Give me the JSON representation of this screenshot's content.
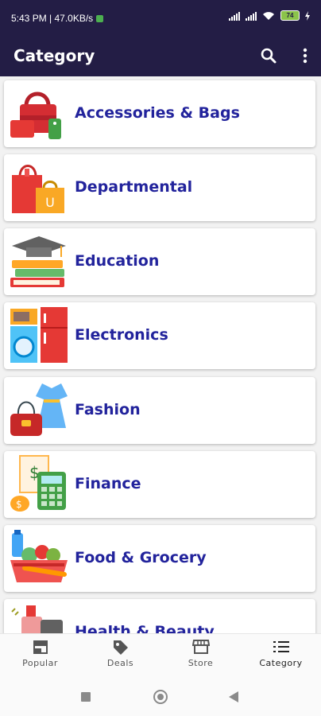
{
  "status_bar": {
    "time_speed": "5:43 PM | 47.0KB/s",
    "battery": "74"
  },
  "app_bar": {
    "title": "Category"
  },
  "categories": [
    {
      "label": "Accessories & Bags",
      "icon": "handbag-icon"
    },
    {
      "label": "Departmental",
      "icon": "shopping-bags-icon"
    },
    {
      "label": "Education",
      "icon": "graduation-books-icon"
    },
    {
      "label": "Electronics",
      "icon": "appliances-icon"
    },
    {
      "label": "Fashion",
      "icon": "dress-purse-icon"
    },
    {
      "label": "Finance",
      "icon": "calculator-money-icon"
    },
    {
      "label": "Food & Grocery",
      "icon": "grocery-basket-icon"
    },
    {
      "label": "Health & Beauty",
      "icon": "beauty-products-icon"
    }
  ],
  "bottom_nav": [
    {
      "label": "Popular",
      "icon": "storefront-icon"
    },
    {
      "label": "Deals",
      "icon": "tag-icon"
    },
    {
      "label": "Store",
      "icon": "store-icon"
    },
    {
      "label": "Category",
      "icon": "list-icon",
      "active": true
    }
  ],
  "colors": {
    "app_bar": "#231d45",
    "label": "#22239c"
  }
}
